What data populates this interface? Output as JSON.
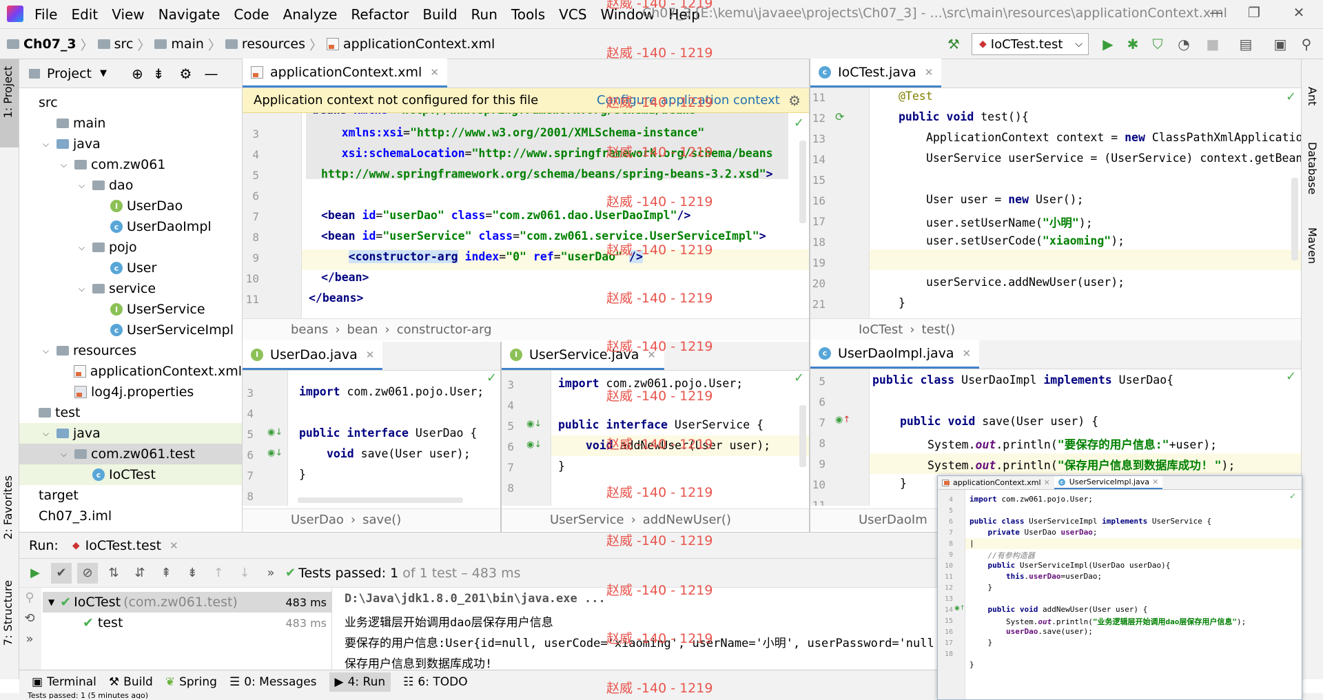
{
  "menu": [
    "File",
    "Edit",
    "View",
    "Navigate",
    "Code",
    "Analyze",
    "Refactor",
    "Build",
    "Run",
    "Tools",
    "VCS",
    "Window",
    "Help"
  ],
  "window_title": "Ch07_3 [E:\\kemu\\javaee\\projects\\Ch07_3] - ...\\src\\main\\resources\\applicationContext.xml",
  "breadcrumb": [
    "Ch07_3",
    "src",
    "main",
    "resources",
    "applicationContext.xml"
  ],
  "run_config": "IoCTest.test",
  "watermark": "赵威 -140 - 1219",
  "left_tabs": {
    "project": "1: Project",
    "favorites": "2: Favorites",
    "structure": "7: Structure"
  },
  "right_tabs": {
    "ant": "Ant",
    "database": "Database",
    "maven": "Maven"
  },
  "project": {
    "title": "Project",
    "tree": [
      {
        "label": "src",
        "indent": 0,
        "type": "none"
      },
      {
        "label": "main",
        "indent": 1,
        "type": "folder",
        "arrow": ""
      },
      {
        "label": "java",
        "indent": 1,
        "type": "folder-blue",
        "arrow": "down"
      },
      {
        "label": "com.zw061",
        "indent": 2,
        "type": "folder",
        "arrow": "down"
      },
      {
        "label": "dao",
        "indent": 3,
        "type": "folder",
        "arrow": "down"
      },
      {
        "label": "UserDao",
        "indent": 4,
        "type": "i"
      },
      {
        "label": "UserDaoImpl",
        "indent": 4,
        "type": "c"
      },
      {
        "label": "pojo",
        "indent": 3,
        "type": "folder",
        "arrow": "down"
      },
      {
        "label": "User",
        "indent": 4,
        "type": "c"
      },
      {
        "label": "service",
        "indent": 3,
        "type": "folder",
        "arrow": "down"
      },
      {
        "label": "UserService",
        "indent": 4,
        "type": "i"
      },
      {
        "label": "UserServiceImpl",
        "indent": 4,
        "type": "c"
      },
      {
        "label": "resources",
        "indent": 1,
        "type": "folder",
        "arrow": "down"
      },
      {
        "label": "applicationContext.xml",
        "indent": 2,
        "type": "xml"
      },
      {
        "label": "log4j.properties",
        "indent": 2,
        "type": "prop"
      },
      {
        "label": "test",
        "indent": 0,
        "type": "folder",
        "arrow": ""
      },
      {
        "label": "java",
        "indent": 1,
        "type": "folder-blue",
        "arrow": "down"
      },
      {
        "label": "com.zw061.test",
        "indent": 2,
        "type": "folder",
        "arrow": "down"
      },
      {
        "label": "IoCTest",
        "indent": 3,
        "type": "c"
      },
      {
        "label": "target",
        "indent": 0,
        "type": "none"
      },
      {
        "label": "Ch07_3.iml",
        "indent": 0,
        "type": "none"
      }
    ]
  },
  "editor_xml": {
    "tab": "applicationContext.xml",
    "banner": "Application context not configured for this file",
    "banner_link": "Configure application context",
    "lines": [
      "3",
      "4",
      "5",
      "6",
      "7",
      "8",
      "9",
      "10",
      "11"
    ],
    "crumbs": [
      "beans",
      "bean",
      "constructor-arg"
    ]
  },
  "editor_ioc": {
    "tab": "IoCTest.java",
    "lines": [
      "11",
      "12",
      "13",
      "14",
      "15",
      "16",
      "17",
      "18",
      "19",
      "20",
      "21"
    ],
    "crumbs": [
      "IoCTest",
      "test()"
    ]
  },
  "editor_userdao": {
    "tab": "UserDao.java",
    "lines": [
      "3",
      "4",
      "5",
      "6",
      "7",
      "8"
    ],
    "crumbs": [
      "UserDao",
      "save()"
    ]
  },
  "editor_userservice": {
    "tab": "UserService.java",
    "lines": [
      "3",
      "4",
      "5",
      "6",
      "7",
      "8"
    ],
    "crumbs": [
      "UserService",
      "addNewUser()"
    ]
  },
  "editor_userdaoimpl": {
    "tab": "UserDaoImpl.java",
    "lines": [
      "5",
      "6",
      "7",
      "8",
      "9",
      "10",
      "11"
    ],
    "crumbs": [
      "UserDaoIm"
    ]
  },
  "run": {
    "label": "Run:",
    "tab": "IoCTest.test",
    "status": "Tests passed: 1",
    "status_extra": "of 1 test – 483 ms",
    "tree": [
      {
        "label": "IoCTest",
        "sub": "(com.zw061.test)",
        "time": "483 ms"
      },
      {
        "label": "test",
        "sub": "",
        "time": "483 ms"
      }
    ],
    "console": [
      "D:\\Java\\jdk1.8.0_201\\bin\\java.exe ...",
      "业务逻辑层开始调用dao层保存用户信息",
      "要保存的用户信息:User{id=null, userCode='xiaoming', userName='小明', userPassword='null',",
      "保存用户信息到数据库成功!"
    ]
  },
  "bottom_tabs": [
    "Terminal",
    "Build",
    "Spring",
    "0: Messages",
    "4: Run",
    "6: TODO"
  ],
  "status_bottom": "Tests passed: 1 (5 minutes ago)",
  "popup": {
    "tabs": [
      "applicationContext.xml",
      "UserServiceImpl.java"
    ],
    "lines": [
      "4",
      "5",
      "6",
      "7",
      "8",
      "9",
      "10",
      "11",
      "12",
      "13",
      "14",
      "15",
      "16",
      "17",
      "18"
    ]
  },
  "colors": {
    "accent": "#4083c9",
    "banner": "#fcf4c4",
    "watermark": "#e8554d",
    "pass": "#4caf50"
  }
}
